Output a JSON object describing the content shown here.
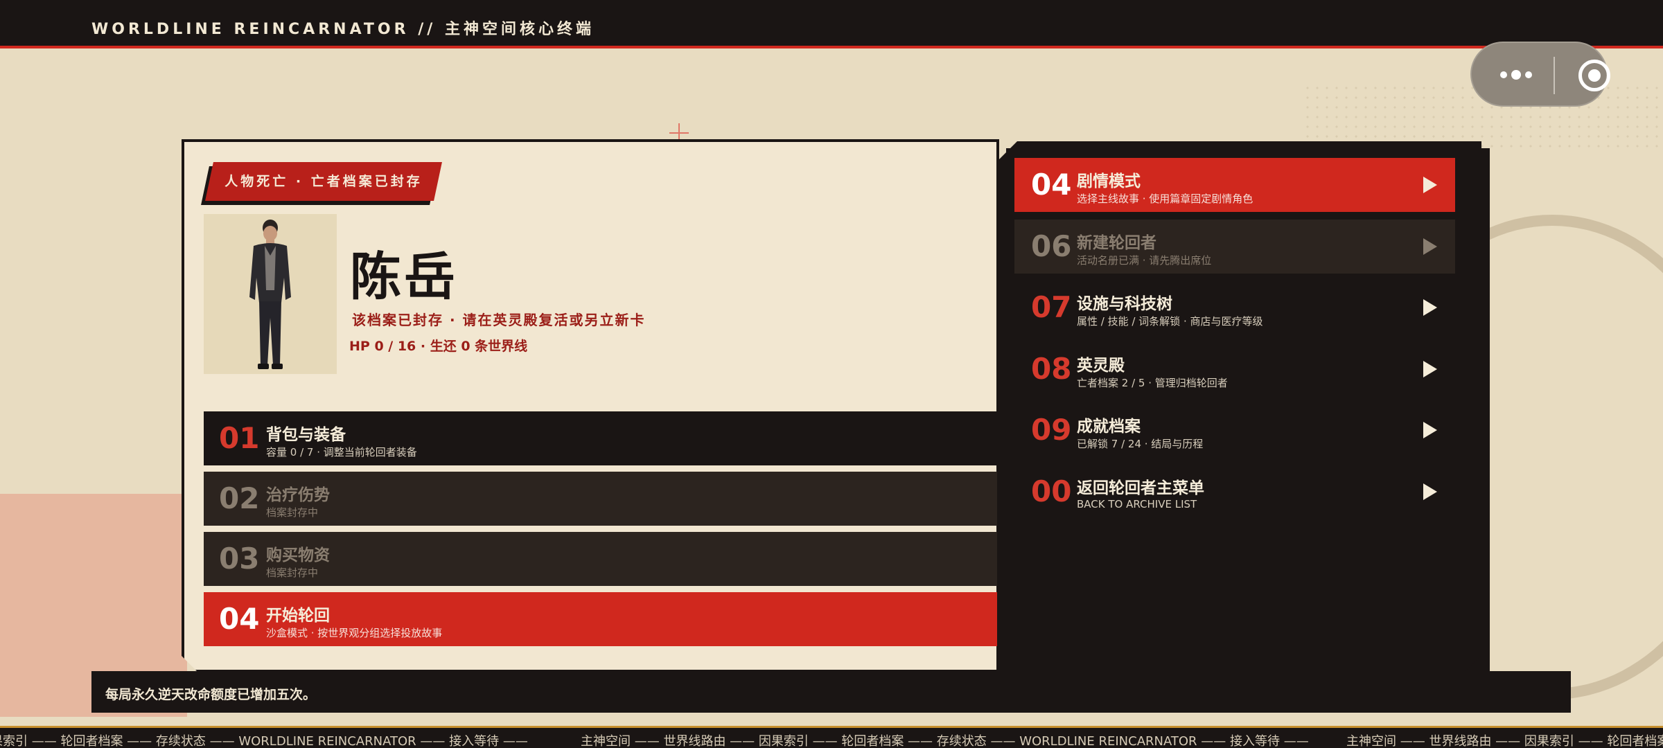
{
  "header": {
    "title": "WORLDLINE REINCARNATOR // 主神空间核心终端"
  },
  "capsule": {
    "more_icon": "more-dots-icon",
    "close_icon": "target-circle-icon"
  },
  "character": {
    "status_tag": "人物死亡 · 亡者档案已封存",
    "name": "陈岳",
    "note": "该档案已封存 · 请在英灵殿复活或另立新卡",
    "hp_line": "HP 0 / 16 · 生还 0 条世界线"
  },
  "left_menu": [
    {
      "num": "01",
      "label": "背包与装备",
      "sub": "容量 0 / 7 · 调整当前轮回者装备",
      "state": "normal"
    },
    {
      "num": "02",
      "label": "治疗伤势",
      "sub": "档案封存中",
      "state": "disabled"
    },
    {
      "num": "03",
      "label": "购买物资",
      "sub": "档案封存中",
      "state": "disabled"
    },
    {
      "num": "04",
      "label": "开始轮回",
      "sub": "沙盒模式 · 按世界观分组选择投放故事",
      "state": "active"
    }
  ],
  "right_menu": [
    {
      "num": "04",
      "label": "剧情模式",
      "sub": "选择主线故事 · 使用篇章固定剧情角色",
      "state": "active"
    },
    {
      "num": "06",
      "label": "新建轮回者",
      "sub": "活动名册已满 · 请先腾出席位",
      "state": "disabled"
    },
    {
      "num": "07",
      "label": "设施与科技树",
      "sub": "属性 / 技能 / 词条解锁 · 商店与医疗等级",
      "state": "normal"
    },
    {
      "num": "08",
      "label": "英灵殿",
      "sub": "亡者档案 2 / 5 · 管理归档轮回者",
      "state": "normal"
    },
    {
      "num": "09",
      "label": "成就档案",
      "sub": "已解锁 7 / 24 · 结局与历程",
      "state": "normal"
    },
    {
      "num": "00",
      "label": "返回轮回者主菜单",
      "sub": "BACK TO ARCHIVE LIST",
      "state": "normal"
    }
  ],
  "toast": {
    "text": "每局永久逆天改命额度已增加五次。"
  },
  "ticker": {
    "segments": [
      "果索引 —— 轮回者档案 —— 存续状态 —— WORLDLINE REINCARNATOR —— 接入等待 ——",
      "主神空间 —— 世界线路由 —— 因果索引 —— 轮回者档案 —— 存续状态 —— WORLDLINE REINCARNATOR —— 接入等待 ——",
      "主神空间 —— 世界线路由 —— 因果索引 —— 轮回者档案 —"
    ]
  },
  "colors": {
    "accent": "#d0281e",
    "dark": "#1a1514",
    "paper": "#f2e7d1",
    "background": "#e8dcc1"
  }
}
